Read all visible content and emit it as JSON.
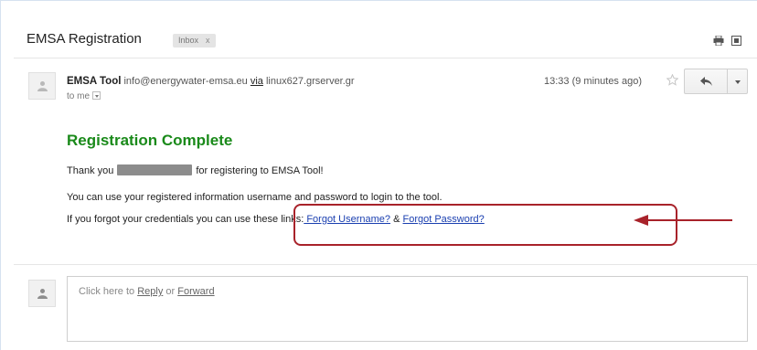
{
  "header": {
    "subject": "EMSA Registration",
    "label": "Inbox",
    "label_close": "x"
  },
  "message": {
    "sender_name": "EMSA Tool",
    "sender_email": "info@energywater-emsa.eu",
    "via_label": "via",
    "via_server": "linux627.grserver.gr",
    "to": "to me",
    "time": "13:33 (9 minutes ago)"
  },
  "body": {
    "title": "Registration Complete",
    "line1_before": "Thank you",
    "line1_after": "for registering to EMSA Tool!",
    "line2": "You can use your registered information username and password to login to the tool.",
    "line3_before": "If you forgot your credentials you can use these links:",
    "link_username": " Forgot Username?",
    "amp": "&",
    "link_password": "Forgot Password?"
  },
  "reply": {
    "prompt_start": "Click here to",
    "reply_link": "Reply",
    "or": "or",
    "forward_link": "Forward"
  },
  "colors": {
    "title_green": "#1a8a1a",
    "link_blue": "#1a3fb0",
    "annotation_red": "#a8222a"
  },
  "icons": [
    "print-icon",
    "popout-icon",
    "star-icon",
    "reply-arrow-icon",
    "person-icon"
  ]
}
